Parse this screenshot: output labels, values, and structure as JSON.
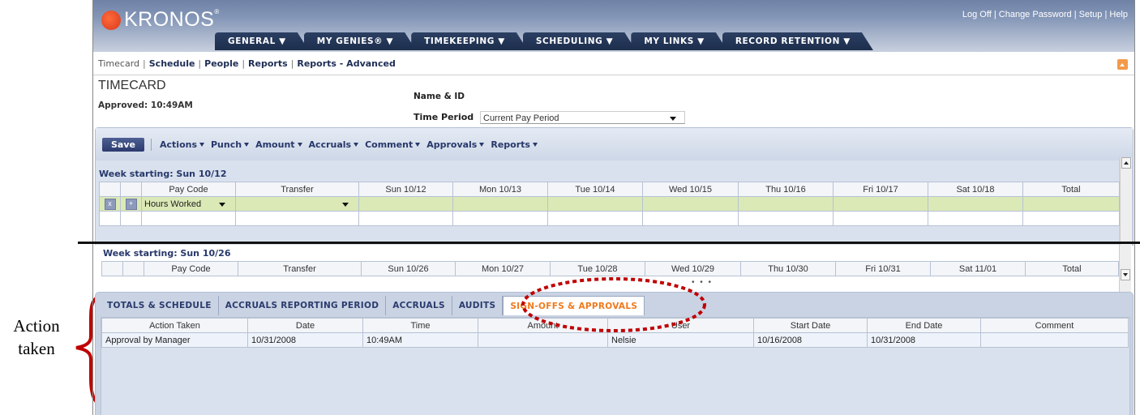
{
  "header": {
    "brand": "KRONOS",
    "top_links": [
      "Log Off",
      "Change Password",
      "Setup",
      "Help"
    ],
    "nav_tabs": [
      "GENERAL",
      "MY GENIES®",
      "TIMEKEEPING",
      "SCHEDULING",
      "MY LINKS",
      "RECORD RETENTION"
    ]
  },
  "subnav": [
    "Timecard",
    "Schedule",
    "People",
    "Reports",
    "Reports - Advanced"
  ],
  "timecard": {
    "title": "TIMECARD",
    "approved": "Approved: 10:49AM",
    "name_id_label": "Name & ID",
    "time_period_label": "Time Period",
    "time_period_value": "Current Pay Period"
  },
  "toolbar": {
    "save_label": "Save",
    "menus": [
      "Actions",
      "Punch",
      "Amount",
      "Accruals",
      "Comment",
      "Approvals",
      "Reports"
    ]
  },
  "week1": {
    "label": "Week starting: Sun 10/12",
    "columns": [
      "Pay Code",
      "Transfer",
      "Sun 10/12",
      "Mon 10/13",
      "Tue 10/14",
      "Wed 10/15",
      "Thu 10/16",
      "Fri 10/17",
      "Sat 10/18",
      "Total"
    ],
    "row1_paycode": "Hours Worked"
  },
  "week2": {
    "label": "Week starting: Sun 10/26",
    "columns": [
      "Pay Code",
      "Transfer",
      "Sun 10/26",
      "Mon 10/27",
      "Tue 10/28",
      "Wed 10/29",
      "Thu 10/30",
      "Fri 10/31",
      "Sat 11/01",
      "Total"
    ]
  },
  "bottom_tabs": [
    "TOTALS & SCHEDULE",
    "ACCRUALS REPORTING PERIOD",
    "ACCRUALS",
    "AUDITS",
    "SIGN-OFFS & APPROVALS"
  ],
  "signoffs": {
    "columns": [
      "Action Taken",
      "Date",
      "Time",
      "Amount",
      "User",
      "Start Date",
      "End Date",
      "Comment"
    ],
    "rows": [
      [
        "Approval by Manager",
        "10/31/2008",
        "10:49AM",
        "",
        "Nelsie",
        "10/16/2008",
        "10/31/2008",
        ""
      ]
    ]
  },
  "annotation": {
    "line1": "Action",
    "line2": "taken",
    "color": "#c00000"
  },
  "colors": {
    "accent_orange": "#f07a1e",
    "nav_dark": "#1d2e4c",
    "row_green": "#dbe9b6"
  }
}
